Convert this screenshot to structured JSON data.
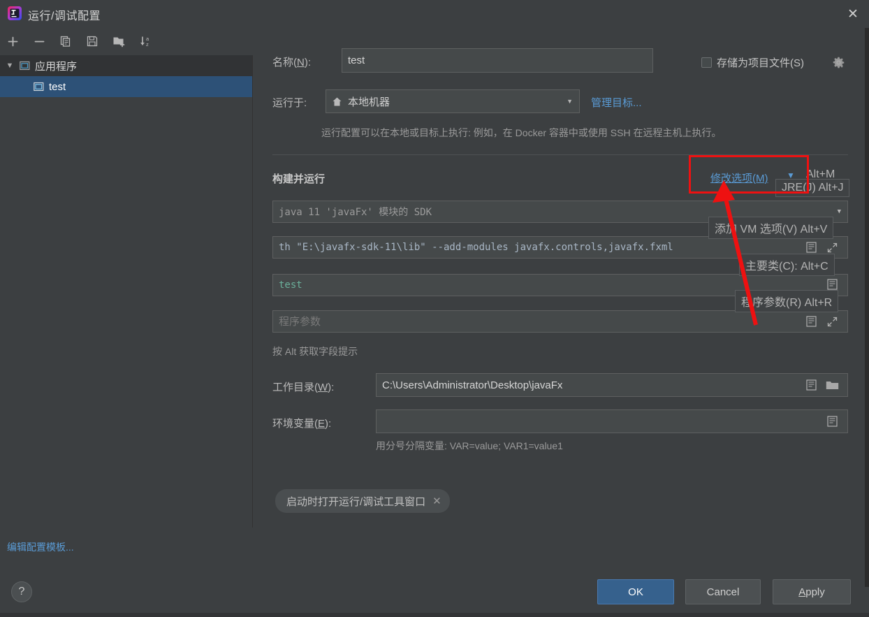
{
  "window": {
    "title": "运行/调试配置",
    "close_label": "✕",
    "app_icon": "intellij-idea-icon"
  },
  "toolbar": {
    "buttons": [
      {
        "name": "add",
        "icon": "plus-icon",
        "glyph": "+"
      },
      {
        "name": "remove",
        "icon": "minus-icon",
        "glyph": "−"
      },
      {
        "name": "copy",
        "icon": "copy-icon",
        "glyph": ""
      },
      {
        "name": "save",
        "icon": "save-icon",
        "glyph": ""
      },
      {
        "name": "new-folder",
        "icon": "folder-add-icon",
        "glyph": ""
      },
      {
        "name": "sort",
        "icon": "sort-az-icon",
        "glyph": ""
      }
    ]
  },
  "tree": {
    "group": {
      "label": "应用程序",
      "icon": "application-icon",
      "expanded": true
    },
    "items": [
      {
        "label": "test",
        "icon": "application-icon",
        "selected": true
      }
    ],
    "edit_templates_link": "编辑配置模板..."
  },
  "form": {
    "name_label": "名称(N):",
    "name_value": "test",
    "store_as_project_file_label": "存储为项目文件(S)",
    "store_as_project_file_checked": false,
    "gear_icon": "gear-icon",
    "run_on_label": "运行于:",
    "run_on_value": "本地机器",
    "run_on_icon": "home-icon",
    "manage_targets_link": "管理目标...",
    "run_on_hint": "运行配置可以在本地或目标上执行: 例如，在 Docker 容器中或使用 SSH 在远程主机上执行。",
    "section_title": "构建并运行",
    "modify_options_link": "修改选项(M)",
    "jre_value": "java 11 'javaFx' 模块的 SDK",
    "vm_options_value": "th \"E:\\javafx-sdk-11\\lib\" --add-modules javafx.controls,javafx.fxml",
    "main_class_value": "test",
    "program_args_placeholder": "程序参数",
    "alt_hint": "按 Alt 获取字段提示",
    "working_dir_label": "工作目录(W):",
    "working_dir_value": "C:\\Users\\Administrator\\Desktop\\javaFx",
    "env_vars_label": "环境变量(E):",
    "env_vars_value": "",
    "env_vars_hint": "用分号分隔变量: VAR=value; VAR1=value1",
    "chip_label": "启动时打开运行/调试工具窗口",
    "chip_close": "✕"
  },
  "mnemonics": [
    {
      "text": "Alt+M",
      "plain": true
    },
    {
      "text": "JRE(J) Alt+J",
      "plain": false
    },
    {
      "text": "添加 VM 选项(V) Alt+V",
      "plain": false
    },
    {
      "text": "主要类(C): Alt+C",
      "plain": false
    },
    {
      "text": "程序参数(R) Alt+R",
      "plain": false
    }
  ],
  "footer": {
    "help_label": "?",
    "ok_label": "OK",
    "cancel_label": "Cancel",
    "apply_label": "Apply"
  },
  "colors": {
    "accent_blue": "#5a9bd5",
    "selection_blue": "#2d5177",
    "primary_button": "#36618d",
    "annotation_red": "#ee1111",
    "panel_bg": "#3c3f41",
    "field_bg": "#45494a"
  }
}
